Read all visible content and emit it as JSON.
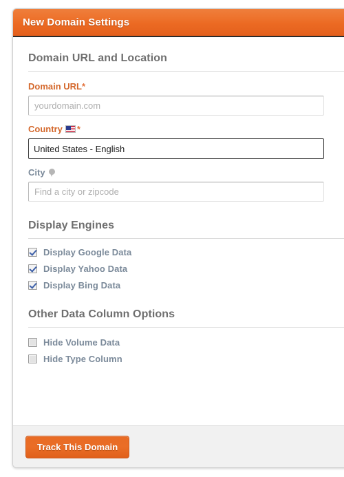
{
  "panel": {
    "title": "New Domain Settings"
  },
  "sections": {
    "location": {
      "heading": "Domain URL and Location",
      "domain_url": {
        "label": "Domain URL",
        "required_mark": "*",
        "placeholder": "yourdomain.com",
        "value": ""
      },
      "country": {
        "label": "Country",
        "required_mark": "*",
        "flag_icon": "us-flag-icon",
        "selected": "United States - English"
      },
      "city": {
        "label": "City",
        "pin_icon": "map-pin-icon",
        "placeholder": "Find a city or zipcode",
        "value": ""
      }
    },
    "engines": {
      "heading": "Display Engines",
      "options": [
        {
          "label": "Display Google Data",
          "checked": true
        },
        {
          "label": "Display Yahoo Data",
          "checked": true
        },
        {
          "label": "Display Bing Data",
          "checked": true
        }
      ]
    },
    "columns": {
      "heading": "Other Data Column Options",
      "options": [
        {
          "label": "Hide Volume Data",
          "checked": false
        },
        {
          "label": "Hide Type Column",
          "checked": false
        }
      ]
    }
  },
  "footer": {
    "submit_label": "Track This Domain"
  },
  "colors": {
    "header_orange": "#ec6a23",
    "button_orange": "#e86b24",
    "label_orange": "#d4682c",
    "heading_gray": "#6f6f6f",
    "checkbox_label": "#7b8a9a",
    "footer_bg": "#f1f1f1"
  }
}
